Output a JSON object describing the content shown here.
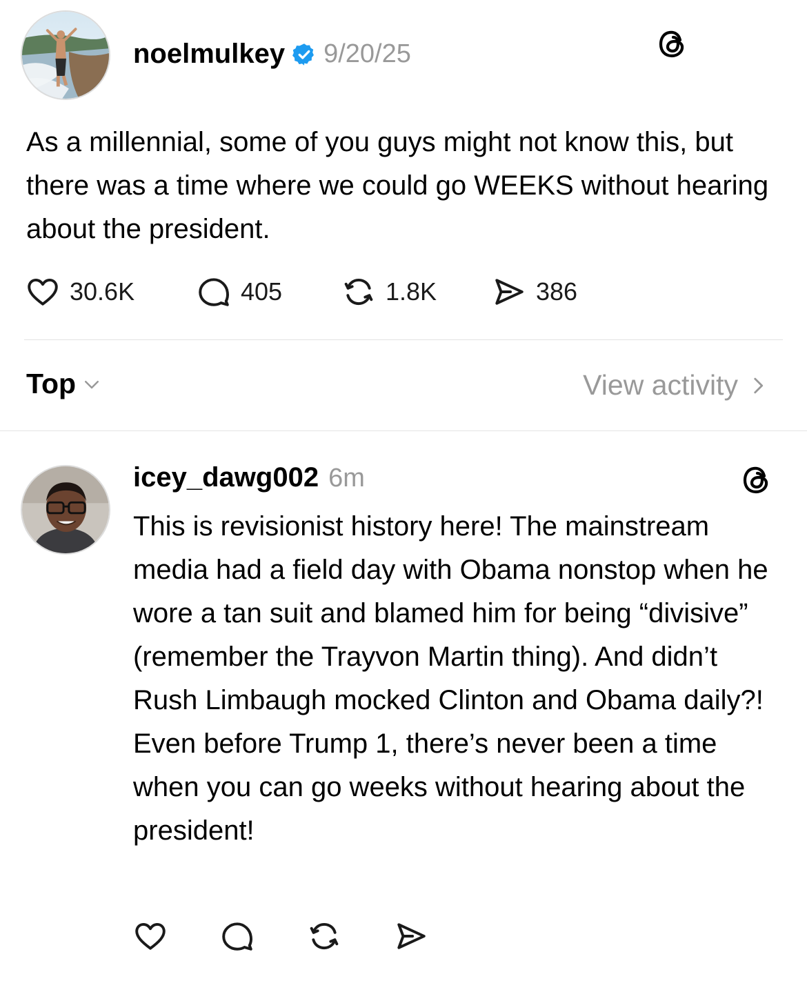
{
  "post": {
    "author": "noelmulkey",
    "verified_icon": "verified-badge-icon",
    "date": "9/20/25",
    "text": "As a millennial, some of you guys might not know this, but there was a time where we could go WEEKS without hearing about the president.",
    "stats": {
      "likes": "30.6K",
      "replies": "405",
      "reposts": "1.8K",
      "shares": "386"
    }
  },
  "sort": {
    "label": "Top",
    "view_activity": "View activity"
  },
  "reply": {
    "author": "icey_dawg002",
    "time": "6m",
    "text": "This is revisionist history here! The mainstream media had a field day with Obama nonstop when he wore a tan suit and blamed him for being “divisive” (remember the Trayvon Martin thing). And didn’t Rush Limbaugh mocked Clinton and Obama daily?! Even before Trump 1, there’s never been a time when you can go weeks without hearing about the president!"
  },
  "colors": {
    "verified": "#1d9bf0",
    "muted": "#999999",
    "divider": "#e3e3e3"
  },
  "icons": [
    "threads-logo-icon",
    "heart-icon",
    "reply-bubble-icon",
    "repost-icon",
    "share-icon",
    "chevron-down-icon",
    "chevron-right-icon"
  ]
}
